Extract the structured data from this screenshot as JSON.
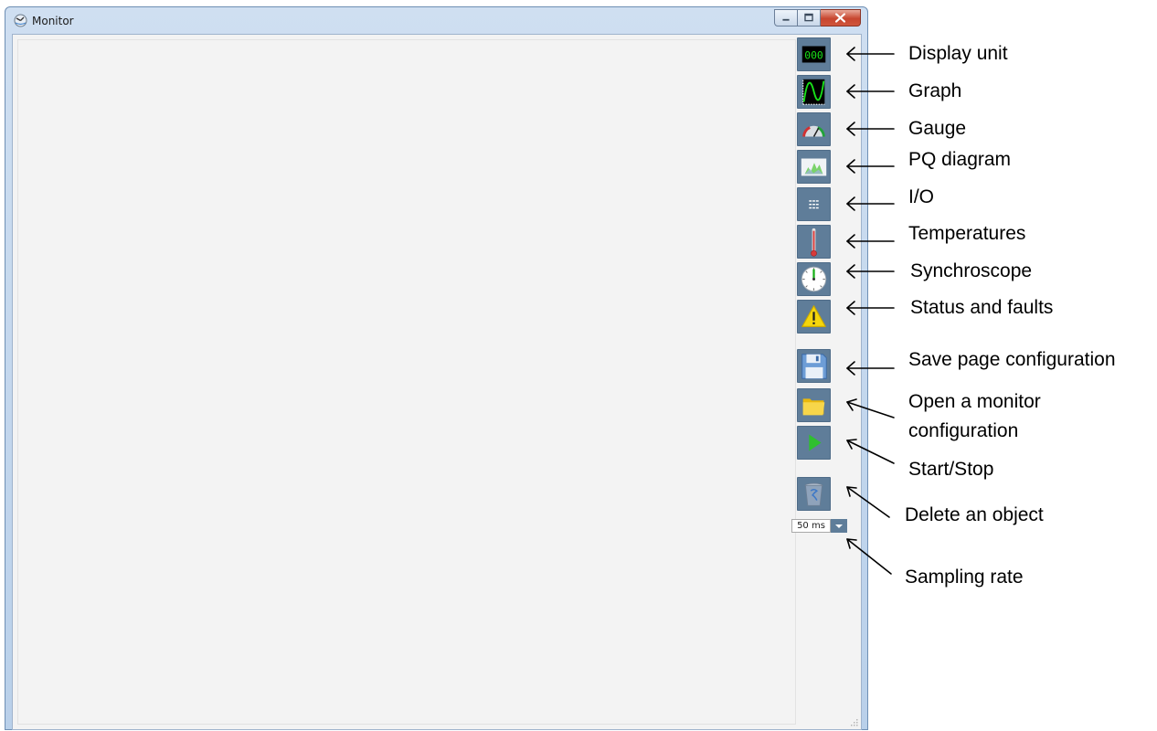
{
  "window": {
    "title": "Monitor",
    "icon": "monitor-app-icon",
    "controls": [
      "minimize-icon",
      "maximize-icon",
      "close-icon"
    ]
  },
  "toolbar": {
    "buttons": [
      {
        "id": "display-unit",
        "icon": "digital-display-icon",
        "digits": "000"
      },
      {
        "id": "graph",
        "icon": "graph-wave-icon"
      },
      {
        "id": "gauge",
        "icon": "gauge-icon"
      },
      {
        "id": "pq-diagram",
        "icon": "pq-diagram-icon"
      },
      {
        "id": "io",
        "icon": "io-grid-icon"
      },
      {
        "id": "temperatures",
        "icon": "thermometer-icon"
      },
      {
        "id": "synchroscope",
        "icon": "synchroscope-icon"
      },
      {
        "id": "status-faults",
        "icon": "warning-icon"
      },
      {
        "id": "save-config",
        "icon": "floppy-disk-icon"
      },
      {
        "id": "open-config",
        "icon": "folder-icon"
      },
      {
        "id": "start-stop",
        "icon": "play-icon"
      },
      {
        "id": "delete-object",
        "icon": "trash-icon"
      }
    ],
    "sampling_rate": {
      "value": "50 ms",
      "icon": "dropdown-arrow-icon"
    }
  },
  "annotations": {
    "display_unit": "Display unit",
    "graph": "Graph",
    "gauge": "Gauge",
    "pq_diagram": "PQ diagram",
    "io": "I/O",
    "temperatures": "Temperatures",
    "synchroscope": "Synchroscope",
    "status_faults": "Status and faults",
    "save_config": "Save page configuration",
    "open_config_line1": "Open a monitor",
    "open_config_line2": "configuration",
    "start_stop": "Start/Stop",
    "delete_object": "Delete an object",
    "sampling_rate": "Sampling rate"
  },
  "colors": {
    "button_bg": "#5f7d99",
    "digits_green": "#19e019",
    "warning_yellow": "#f5d60c",
    "play_green": "#2fbf2f",
    "close_red": "#c7462f"
  }
}
